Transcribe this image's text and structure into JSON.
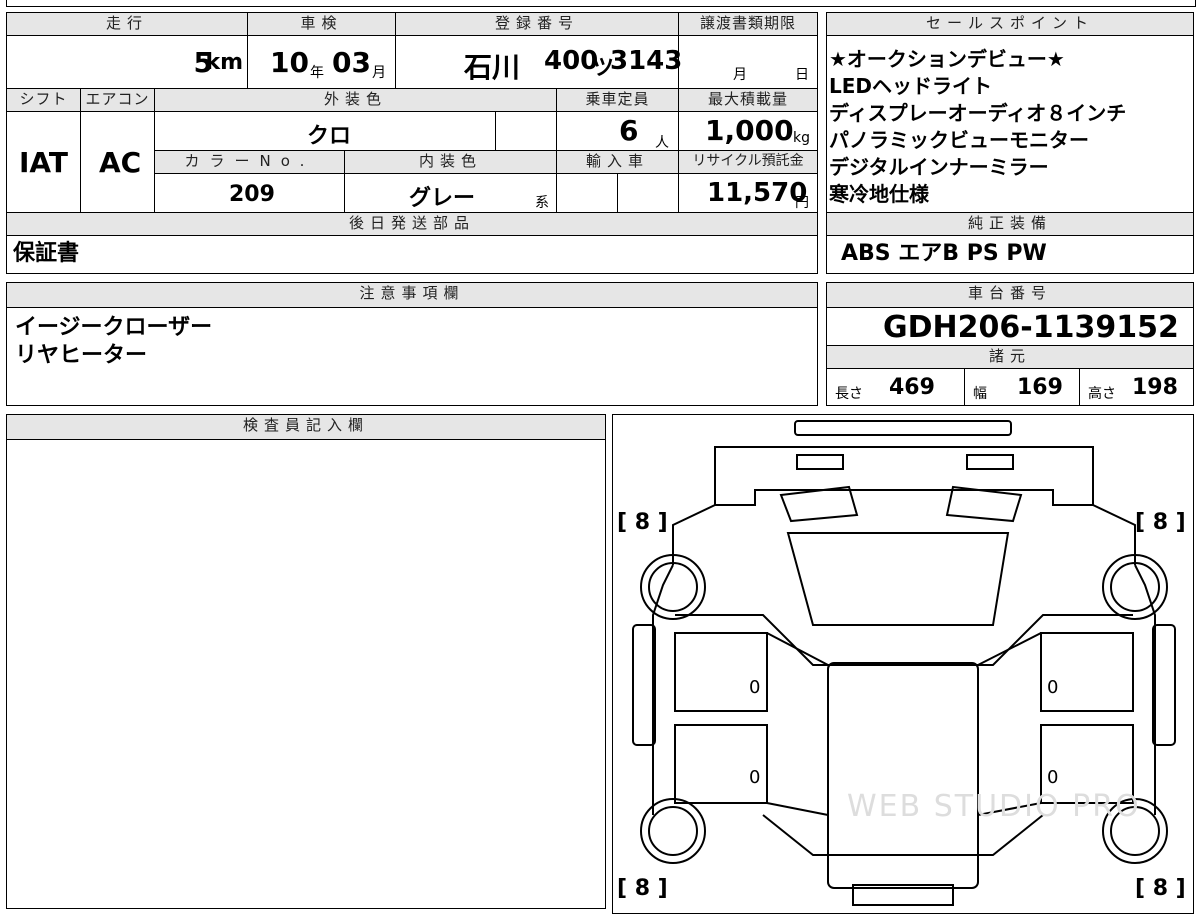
{
  "top_header": {
    "mileage_label": "走行",
    "inspection_label": "車検",
    "registration_label": "登録番号",
    "transfer_deadline_label": "譲渡書類期限",
    "sales_points_label": "セールスポイント"
  },
  "top_values": {
    "mileage": "5",
    "mileage_unit": "km",
    "inspection_year": "10",
    "inspection_year_unit": "年",
    "inspection_month": "03",
    "inspection_month_unit": "月",
    "plate_region": "石川",
    "plate_class": "400",
    "plate_kana": "ツ",
    "plate_number": "3143",
    "deadline_month_unit": "月",
    "deadline_day_unit": "日"
  },
  "sales_points": [
    "★オークションデビュー★",
    "LEDヘッドライト",
    "ディスプレーオーディオ８インチ",
    "パノラミックビューモニター",
    "デジタルインナーミラー",
    "寒冷地仕様"
  ],
  "row2_header": {
    "shift_label": "シフト",
    "ac_label": "エアコン",
    "exterior_color_label": "外装色",
    "capacity_label": "乗車定員",
    "max_load_label": "最大積載量"
  },
  "row2_values": {
    "shift": "IAT",
    "ac": "AC",
    "exterior_color": "クロ",
    "capacity": "6",
    "capacity_unit": "人",
    "max_load": "1,000",
    "max_load_unit": "kg"
  },
  "row3_header": {
    "color_no_label": "カラーNo.",
    "interior_color_label": "内装色",
    "import_label": "輸入車",
    "recycle_label": "リサイクル預託金"
  },
  "row3_values": {
    "color_no": "209",
    "interior_color": "グレー",
    "interior_suffix": "系",
    "recycle_fee": "11,570",
    "recycle_unit": "円"
  },
  "later_parts": {
    "label": "後日発送部品",
    "value": "保証書"
  },
  "genuine_equipment": {
    "label": "純正装備",
    "value": "ABS エアB PS PW"
  },
  "notes": {
    "label": "注意事項欄",
    "lines": [
      "イージークローザー",
      "リヤヒーター"
    ]
  },
  "chassis": {
    "label": "車台番号",
    "value": "GDH206-1139152"
  },
  "specs": {
    "label": "諸元",
    "length_label": "長さ",
    "length": "469",
    "width_label": "幅",
    "width": "169",
    "height_label": "高さ",
    "height": "198"
  },
  "inspector": {
    "label": "検査員記入欄"
  },
  "diagram": {
    "tire_fl": "[ 8 ]",
    "tire_fr": "[ 8 ]",
    "tire_rl": "[ 8 ]",
    "tire_rr": "[ 8 ]",
    "panel_l1": "0",
    "panel_l2": "0",
    "panel_r1": "0",
    "panel_r2": "0",
    "watermark": "WEB STUDIO PRO"
  }
}
